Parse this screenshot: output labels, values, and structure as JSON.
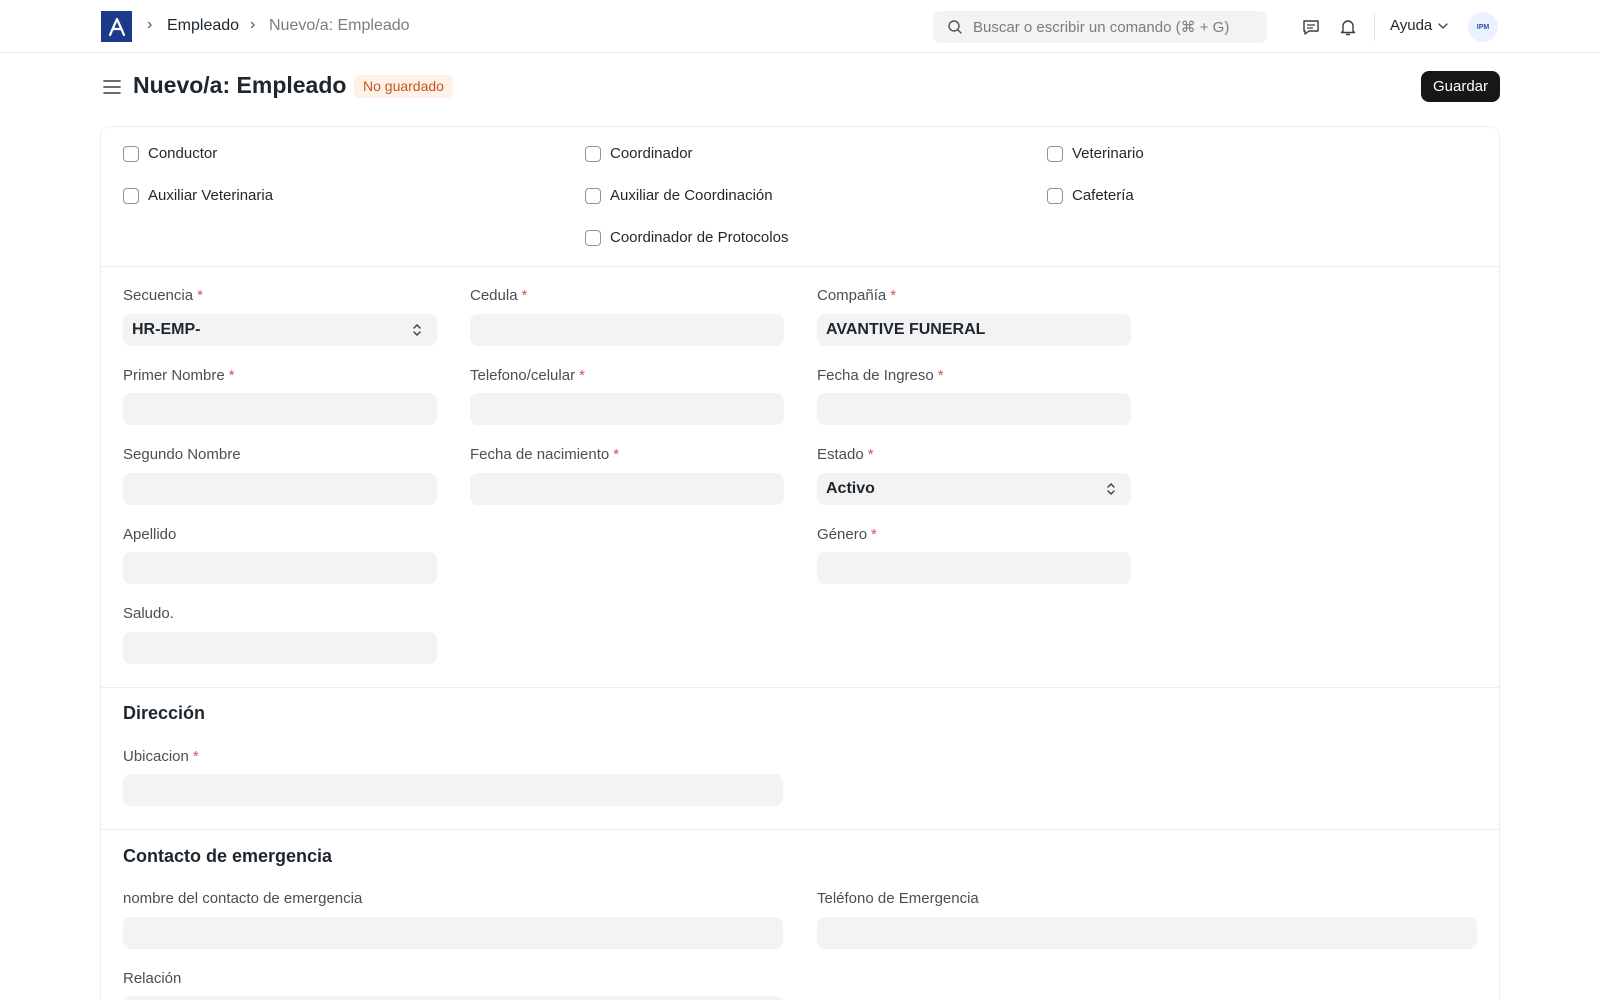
{
  "navbar": {
    "logo": "A",
    "breadcrumbs": [
      "Empleado",
      "Nuevo/a: Empleado"
    ],
    "search_placeholder": "Buscar o escribir un comando (⌘ + G)",
    "help_label": "Ayuda",
    "avatar_initials": "IPM"
  },
  "page": {
    "title": "Nuevo/a: Empleado",
    "status": "No guardado",
    "save_label": "Guardar"
  },
  "checkboxes": {
    "conductor": "Conductor",
    "coordinador": "Coordinador",
    "veterinario": "Veterinario",
    "auxiliar_veterinaria": "Auxiliar Veterinaria",
    "auxiliar_coordinacion": "Auxiliar de Coordinación",
    "cafeteria": "Cafetería",
    "coordinador_protocolos": "Coordinador de Protocolos"
  },
  "fields": {
    "secuencia": {
      "label": "Secuencia",
      "value": "HR-EMP-"
    },
    "primer_nombre": {
      "label": "Primer Nombre",
      "value": ""
    },
    "segundo_nombre": {
      "label": "Segundo Nombre",
      "value": ""
    },
    "apellido": {
      "label": "Apellido",
      "value": ""
    },
    "saludo": {
      "label": "Saludo.",
      "value": ""
    },
    "cedula": {
      "label": "Cedula",
      "value": ""
    },
    "telefono": {
      "label": "Telefono/celular",
      "value": ""
    },
    "fecha_nacimiento": {
      "label": "Fecha de nacimiento",
      "value": ""
    },
    "compania": {
      "label": "Compañía",
      "value": "AVANTIVE FUNERAL"
    },
    "fecha_ingreso": {
      "label": "Fecha de Ingreso",
      "value": ""
    },
    "estado": {
      "label": "Estado",
      "value": "Activo"
    },
    "genero": {
      "label": "Género",
      "value": ""
    }
  },
  "direccion": {
    "title": "Dirección",
    "ubicacion": {
      "label": "Ubicacion",
      "value": ""
    }
  },
  "emergencia": {
    "title": "Contacto de emergencia",
    "nombre": {
      "label": "nombre del contacto de emergencia",
      "value": ""
    },
    "telefono": {
      "label": "Teléfono de Emergencia",
      "value": ""
    },
    "relacion": {
      "label": "Relación",
      "value": ""
    }
  },
  "required_marker": "*"
}
